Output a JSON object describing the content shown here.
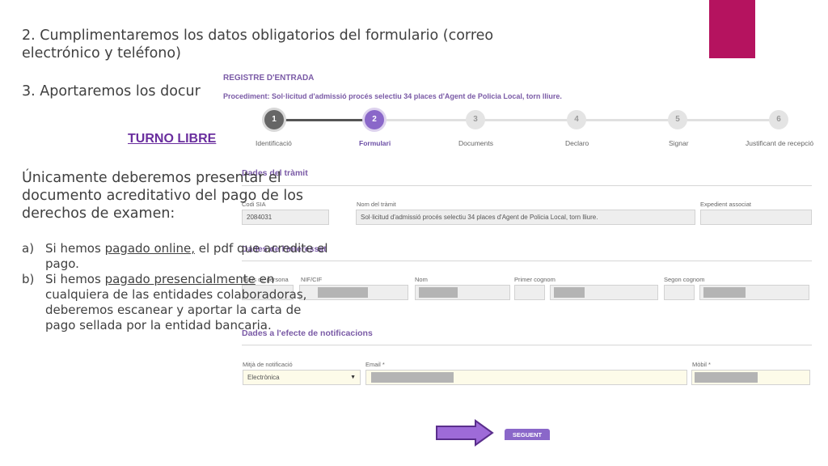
{
  "slide": {
    "accent_color": "#b5135f",
    "step2": "2. Cumplimentaremos los datos obligatorios del formulario (correo electrónico y teléfono)",
    "step3": "3. Aportaremos los docur",
    "turno": "TURNO LIBRE",
    "intro": "Únicamente deberemos presentar el documento acreditativo del pago de los derechos de examen:",
    "items": [
      {
        "label": "a)",
        "pre": "Si hemos ",
        "link": "pagado online,",
        "post": " el pdf que acredite el pago."
      },
      {
        "label": "b)",
        "pre": "Si hemos ",
        "link": "pagado presencialmente",
        "post": " en cualquiera de las entidades colaboradoras, deberemos escanear y aportar la carta de pago sellada por la entidad bancaria."
      }
    ]
  },
  "form": {
    "title": "REGISTRE D'ENTRADA",
    "procedure": "Procediment: Sol·licitud d'admissió procés selectiu 34 places d'Agent de Policia Local, torn lliure.",
    "steps": [
      {
        "num": "1",
        "label": "Identificació"
      },
      {
        "num": "2",
        "label": "Formulari"
      },
      {
        "num": "3",
        "label": "Documents"
      },
      {
        "num": "4",
        "label": "Declaro"
      },
      {
        "num": "5",
        "label": "Signar"
      },
      {
        "num": "6",
        "label": "Justificant de recepció"
      }
    ],
    "tramit": {
      "section": "Dades del tràmit",
      "code_label": "Codi SIA",
      "code_value": "2084031",
      "name_label": "Nom del tràmit",
      "name_value": "Sol·licitud d'admissió procés selectiu 34 places d'Agent de Policia Local, torn lliure.",
      "exp_label": "Expedient associat",
      "exp_value": ""
    },
    "interessat": {
      "section": "Dades de l'interessat",
      "persona_label": "Tipus de persona",
      "nif_label": "NIF/CIF",
      "nom_label": "Nom",
      "cognom1_label": "Primer cognom",
      "cognom2_label": "Segon cognom"
    },
    "notificacions": {
      "section": "Dades a l'efecte de notificacions",
      "mitja_label": "Mitjà de notificació",
      "mitja_value": "Electrònica",
      "email_label": "Email *",
      "mobil_label": "Mòbil *"
    },
    "next_button": "SEGUENT"
  }
}
